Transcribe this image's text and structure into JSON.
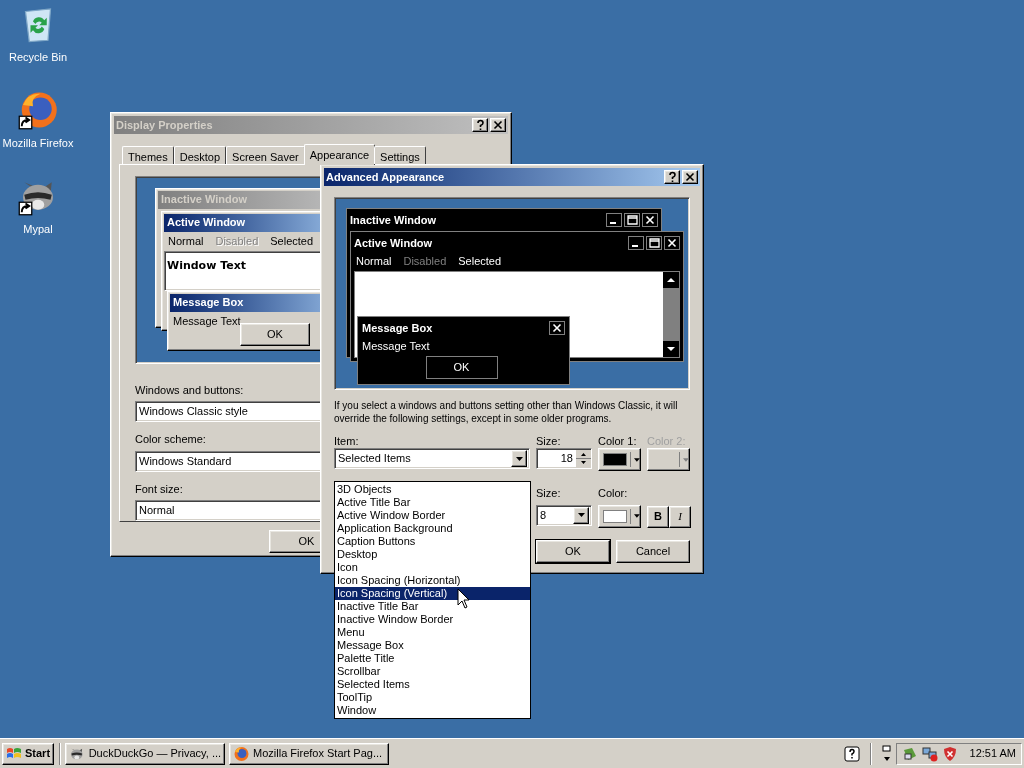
{
  "desktop_icons": [
    {
      "label": "Recycle Bin",
      "kind": "recycle",
      "shortcut": false
    },
    {
      "label": "Mozilla Firefox",
      "kind": "firefox",
      "shortcut": true
    },
    {
      "label": "Mypal",
      "kind": "raccoon",
      "shortcut": true
    }
  ],
  "display_properties": {
    "title": "Display Properties",
    "tabs": [
      {
        "label": "Themes",
        "selected": false
      },
      {
        "label": "Desktop",
        "selected": false
      },
      {
        "label": "Screen Saver",
        "selected": false
      },
      {
        "label": "Appearance",
        "selected": true
      },
      {
        "label": "Settings",
        "selected": false
      }
    ],
    "preview": {
      "inactive_title": "Inactive Window",
      "active_title": "Active Window",
      "menu": [
        {
          "label": "Normal",
          "kind": "normal"
        },
        {
          "label": "Disabled",
          "kind": "disabled"
        },
        {
          "label": "Selected",
          "kind": "selected"
        }
      ],
      "window_text": "Window Text",
      "message_title": "Message Box",
      "message_text": "Message Text",
      "ok": "OK"
    },
    "fields": [
      {
        "label": "Windows and buttons:",
        "value": "Windows Classic style"
      },
      {
        "label": "Color scheme:",
        "value": "Windows Standard"
      },
      {
        "label": "Font size:",
        "value": "Normal"
      }
    ],
    "buttons": [
      "OK"
    ]
  },
  "advanced": {
    "title": "Advanced Appearance",
    "preview": {
      "inactive_title": "Inactive Window",
      "active_title": "Active Window",
      "menu": [
        {
          "label": "Normal",
          "kind": "normal"
        },
        {
          "label": "Disabled",
          "kind": "disabled"
        },
        {
          "label": "Selected",
          "kind": "selected"
        }
      ],
      "message_title": "Message Box",
      "message_text": "Message Text",
      "ok": "OK"
    },
    "note": "If you select a windows and buttons setting other than Windows Classic, it will override the following settings, except in some older programs.",
    "item": {
      "label": "Item:",
      "value": "Selected Items"
    },
    "size": {
      "label": "Size:",
      "value": "18"
    },
    "color1": {
      "label": "Color 1:",
      "color": "#000000"
    },
    "color2": {
      "label": "Color 2:",
      "disabled": true
    },
    "font_size": {
      "label": "Size:",
      "value": "8"
    },
    "font_color": {
      "label": "Color:",
      "color": "#ffffff"
    },
    "bold": "B",
    "italic": "I",
    "buttons": [
      "OK",
      "Cancel"
    ]
  },
  "item_list": [
    {
      "label": "3D Objects",
      "selected": false
    },
    {
      "label": "Active Title Bar",
      "selected": false
    },
    {
      "label": "Active Window Border",
      "selected": false
    },
    {
      "label": "Application Background",
      "selected": false
    },
    {
      "label": "Caption Buttons",
      "selected": false
    },
    {
      "label": "Desktop",
      "selected": false
    },
    {
      "label": "Icon",
      "selected": false
    },
    {
      "label": "Icon Spacing (Horizontal)",
      "selected": false
    },
    {
      "label": "Icon Spacing (Vertical)",
      "selected": true
    },
    {
      "label": "Inactive Title Bar",
      "selected": false
    },
    {
      "label": "Inactive Window Border",
      "selected": false
    },
    {
      "label": "Menu",
      "selected": false
    },
    {
      "label": "Message Box",
      "selected": false
    },
    {
      "label": "Palette Title",
      "selected": false
    },
    {
      "label": "Scrollbar",
      "selected": false
    },
    {
      "label": "Selected Items",
      "selected": false
    },
    {
      "label": "ToolTip",
      "selected": false
    },
    {
      "label": "Window",
      "selected": false
    }
  ],
  "taskbar": {
    "start": "Start",
    "tasks": [
      {
        "label": "DuckDuckGo — Privacy, ...",
        "kind": "raccoon"
      },
      {
        "label": "Mozilla Firefox Start Pag...",
        "kind": "firefox"
      }
    ],
    "clock": "12:51 AM"
  }
}
